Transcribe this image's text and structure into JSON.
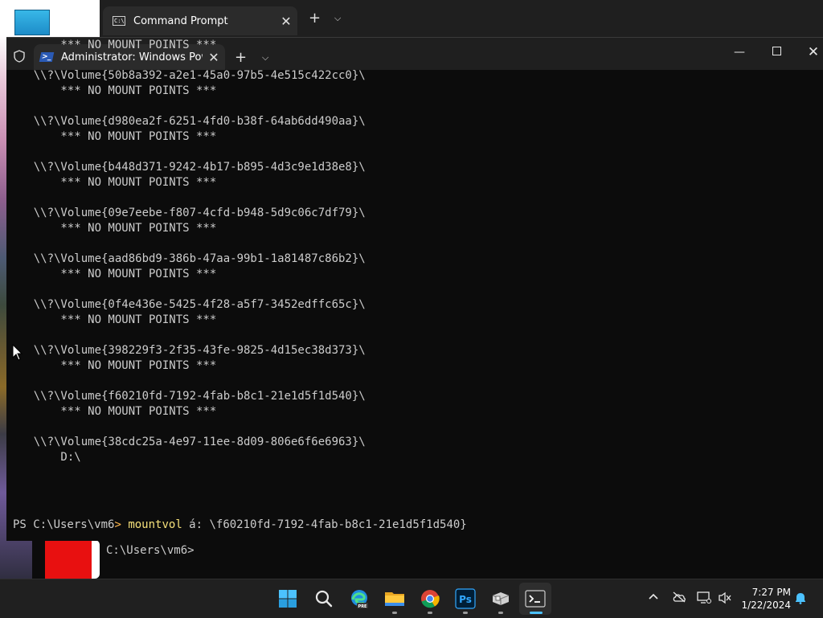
{
  "cmd_window": {
    "tab_title": "Command Prompt",
    "tab_icon_text": "C:\\",
    "prompt": "C:\\Users\\vm6>"
  },
  "ps_window": {
    "tab_title": "Administrator: Windows Powe",
    "icon_text": ">_"
  },
  "terminal_lines": [
    "    *** NO MOUNT POINTS ***",
    "",
    "\\\\?\\Volume{50b8a392-a2e1-45a0-97b5-4e515c422cc0}\\",
    "    *** NO MOUNT POINTS ***",
    "",
    "\\\\?\\Volume{d980ea2f-6251-4fd0-b38f-64ab6dd490aa}\\",
    "    *** NO MOUNT POINTS ***",
    "",
    "\\\\?\\Volume{b448d371-9242-4b17-b895-4d3c9e1d38e8}\\",
    "    *** NO MOUNT POINTS ***",
    "",
    "\\\\?\\Volume{09e7eebe-f807-4cfd-b948-5d9c06c7df79}\\",
    "    *** NO MOUNT POINTS ***",
    "",
    "\\\\?\\Volume{aad86bd9-386b-47aa-99b1-1a81487c86b2}\\",
    "    *** NO MOUNT POINTS ***",
    "",
    "\\\\?\\Volume{0f4e436e-5425-4f28-a5f7-3452edffc65c}\\",
    "    *** NO MOUNT POINTS ***",
    "",
    "\\\\?\\Volume{398229f3-2f35-43fe-9825-4d15ec38d373}\\",
    "    *** NO MOUNT POINTS ***",
    "",
    "\\\\?\\Volume{f60210fd-7192-4fab-b8c1-21e1d5f1d540}\\",
    "    *** NO MOUNT POINTS ***",
    "",
    "\\\\?\\Volume{38cdc25a-4e97-11ee-8d09-806e6f6e6963}\\",
    "    D:\\"
  ],
  "command_line": {
    "prompt": "PS C:\\Users\\vm6",
    "arrow": ">",
    "command": "mountvol",
    "args": " á: \\f60210fd-7192-4fab-b8c1-21e1d5f1d540}"
  },
  "taskbar": {
    "time": "7:27 PM",
    "date": "1/22/2024",
    "edge_badge": "PRE",
    "photoshop_label": "Ps",
    "apps": [
      "start-icon",
      "search-icon",
      "edge-icon",
      "file-explorer-icon",
      "chrome-icon",
      "photoshop-icon",
      "vmware-icon",
      "terminal-icon"
    ]
  },
  "colors": {
    "terminal_bg": "#0c0c0c",
    "prompt_arrow": "#ffb84d",
    "command": "#f5e07a",
    "accent": "#4cc2ff"
  }
}
